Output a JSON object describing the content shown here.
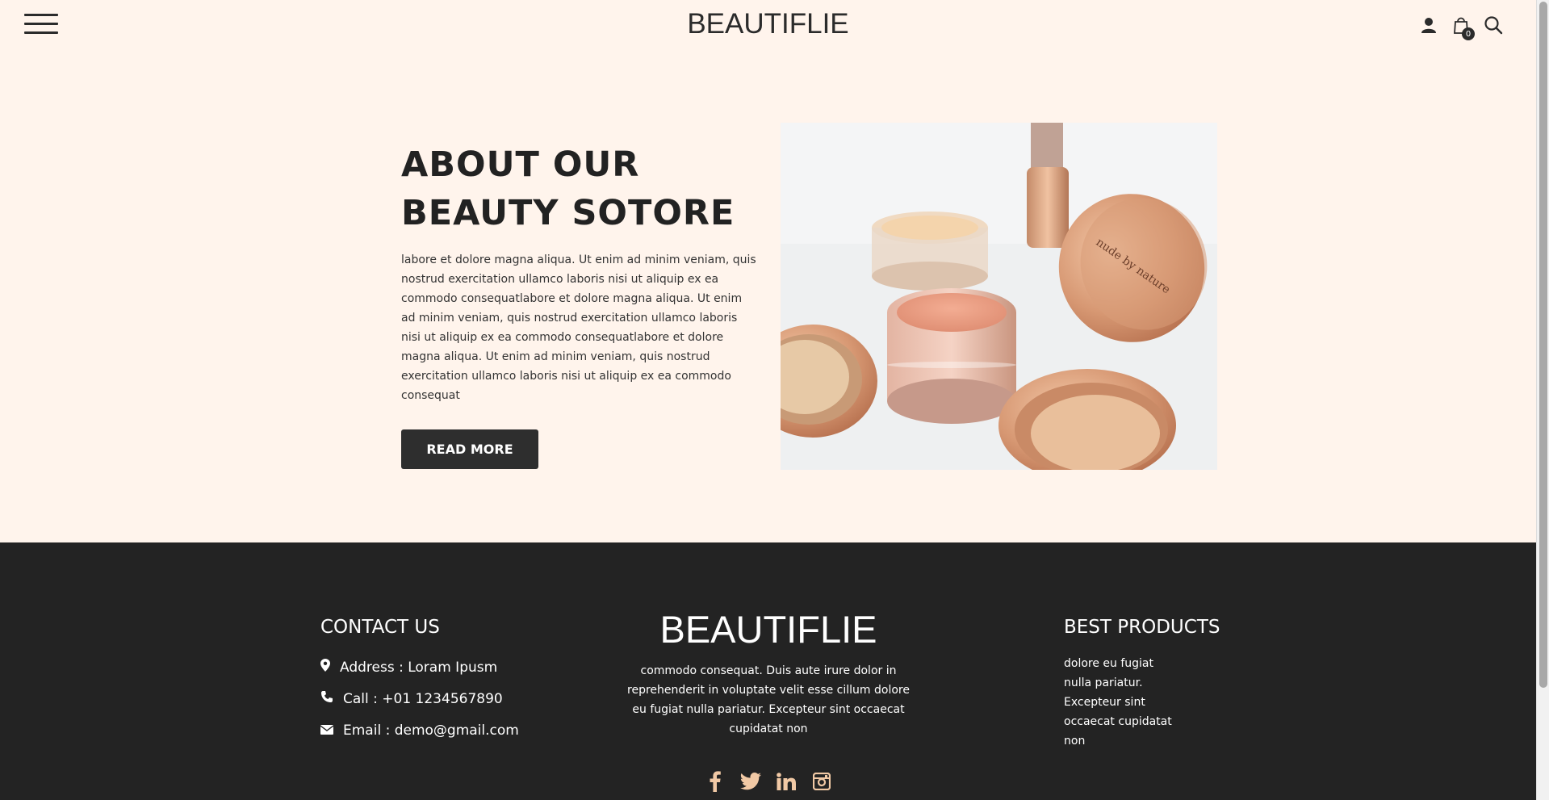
{
  "header": {
    "logo": "BEAUTIFLIE",
    "cart_count": "0",
    "icons": [
      "menu-icon",
      "user-icon",
      "cart-icon",
      "search-icon"
    ]
  },
  "about": {
    "title_line1": "ABOUT OUR",
    "title_line2": "BEAUTY SOTORE",
    "body": "labore et dolore magna aliqua. Ut enim ad minim veniam, quis nostrud exercitation ullamco laboris nisi ut aliquip ex ea commodo consequatlabore et dolore magna aliqua. Ut enim ad minim veniam, quis nostrud exercitation ullamco laboris nisi ut aliquip ex ea commodo consequatlabore et dolore magna aliqua. Ut enim ad minim veniam, quis nostrud exercitation ullamco laboris nisi ut aliquip ex ea commodo consequat",
    "button_label": "READ MORE"
  },
  "footer": {
    "contact_heading": "CONTACT US",
    "address": "Address : Loram Ipusm",
    "call": "Call : +01 1234567890",
    "email": "Email : demo@gmail.com",
    "logo": "BEAUTIFLIE",
    "description": "commodo consequat. Duis aute irure dolor in reprehenderit in voluptate velit esse cillum dolore eu fugiat nulla pariatur. Excepteur sint occaecat cupidatat non",
    "products_heading": "BEST PRODUCTS",
    "products": [
      "dolore eu fugiat",
      "nulla pariatur.",
      "Excepteur sint",
      "occaecat cupidatat",
      "non"
    ],
    "socials": [
      "facebook-icon",
      "twitter-icon",
      "linkedin-icon",
      "instagram-icon"
    ]
  },
  "colors": {
    "page_bg": "#fff4ec",
    "footer_bg": "#232323",
    "button_bg": "#2e2e2e",
    "social_accent": "#f1c9a5"
  }
}
